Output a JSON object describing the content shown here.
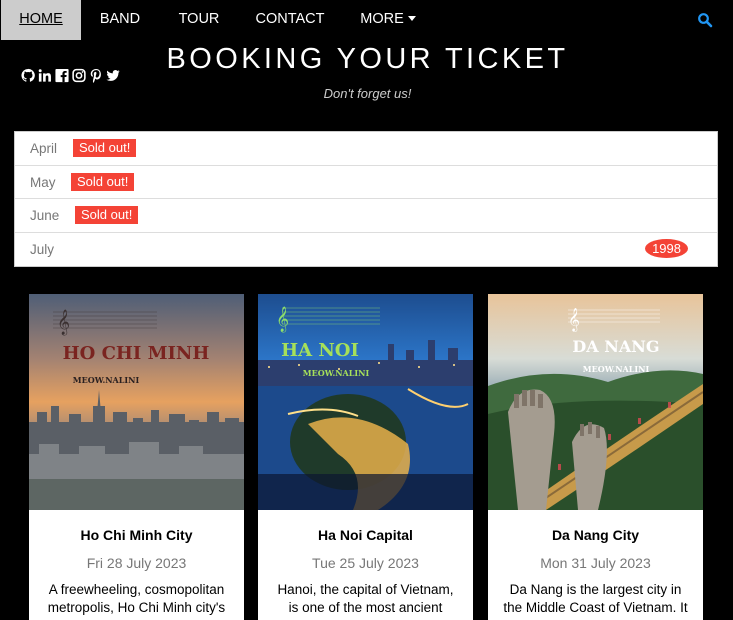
{
  "nav": {
    "items": [
      "HOME",
      "BAND",
      "TOUR",
      "CONTACT"
    ],
    "more_label": "MORE",
    "search_icon": "search-icon"
  },
  "header": {
    "social_icons": [
      "github-icon",
      "linkedin-icon",
      "facebook-icon",
      "instagram-icon",
      "pinterest-icon",
      "twitter-icon"
    ],
    "title": "BOOKING YOUR TICKET",
    "subtitle": "Don't forget us!"
  },
  "tickets": [
    {
      "month": "April",
      "badge": "Sold out!"
    },
    {
      "month": "May",
      "badge": "Sold out!"
    },
    {
      "month": "June",
      "badge": "Sold out!"
    },
    {
      "month": "July",
      "count": "1998"
    }
  ],
  "cards": [
    {
      "poster_title": "HO CHI MINH",
      "poster_sub": "MEOW.NALINI",
      "title": "Ho Chi Minh City",
      "date": "Fri 28 July 2023",
      "desc": "A freewheeling, cosmopolitan metropolis, Ho Chi Minh city's"
    },
    {
      "poster_title": "HA NOI",
      "poster_sub": "MEOW.NALINI",
      "title": "Ha Noi Capital",
      "date": "Tue 25 July 2023",
      "desc": "Hanoi, the capital of Vietnam, is one of the most ancient cities in"
    },
    {
      "poster_title": "DA NANG",
      "poster_sub": "MEOW.NALINI",
      "title": "Da Nang City",
      "date": "Mon 31 July 2023",
      "desc": "Da Nang is the largest city in the Middle Coast of Vietnam. It offers"
    }
  ],
  "colors": {
    "badge": "#f44336",
    "nav_active": "#cccccc",
    "search": "#2196f3"
  }
}
